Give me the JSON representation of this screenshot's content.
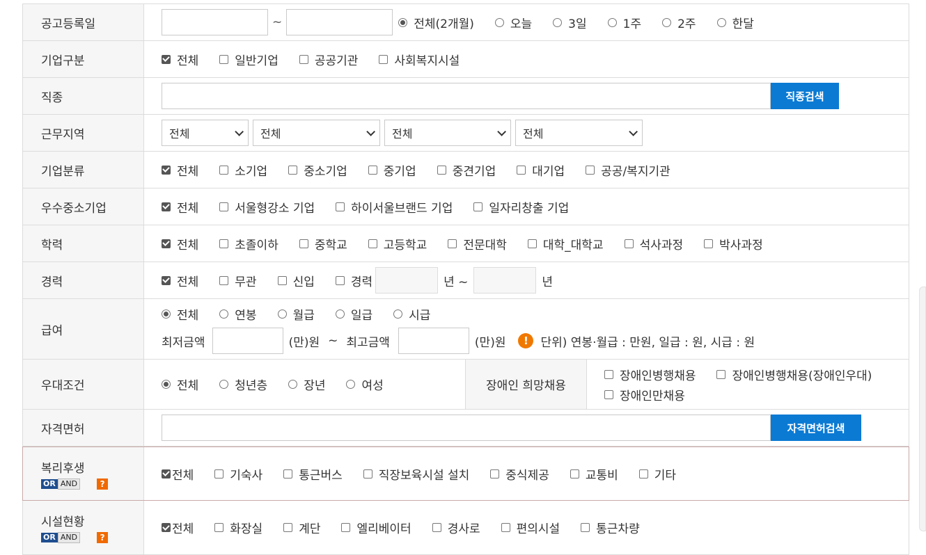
{
  "rows": {
    "posting_date": {
      "label": "공고등록일",
      "tilde": "~",
      "options": [
        "전체(2개월)",
        "오늘",
        "3일",
        "1주",
        "2주",
        "한달"
      ]
    },
    "company_type": {
      "label": "기업구분",
      "options": [
        "전체",
        "일반기업",
        "공공기관",
        "사회복지시설"
      ]
    },
    "job_type": {
      "label": "직종",
      "button": "직종검색"
    },
    "work_area": {
      "label": "근무지역",
      "selects": [
        "전체",
        "전체",
        "전체",
        "전체"
      ]
    },
    "company_class": {
      "label": "기업분류",
      "options": [
        "전체",
        "소기업",
        "중소기업",
        "중기업",
        "중견기업",
        "대기업",
        "공공/복지기관"
      ]
    },
    "excellent_sme": {
      "label": "우수중소기업",
      "options": [
        "전체",
        "서울형강소 기업",
        "하이서울브랜드 기업",
        "일자리창출 기업"
      ]
    },
    "education": {
      "label": "학력",
      "options": [
        "전체",
        "초졸이하",
        "중학교",
        "고등학교",
        "전문대학",
        "대학_대학교",
        "석사과정",
        "박사과정"
      ]
    },
    "career": {
      "label": "경력",
      "options": [
        "전체",
        "무관",
        "신입",
        "경력"
      ],
      "year_from": "년 ~",
      "year_to": "년"
    },
    "salary": {
      "label": "급여",
      "options": [
        "전체",
        "연봉",
        "월급",
        "일급",
        "시급"
      ],
      "min_label": "최저금액",
      "unit1": "(만)원",
      "tilde": "~",
      "max_label": "최고금액",
      "unit2": "(만)원",
      "warn_glyph": "!",
      "unit_note": "단위) 연봉·월급 : 만원, 일급 : 원, 시급 : 원"
    },
    "preference": {
      "label": "우대조건",
      "options": [
        "전체",
        "청년층",
        "장년",
        "여성"
      ],
      "disabled_label": "장애인 희망채용",
      "disabled_options": [
        "장애인병행채용",
        "장애인병행채용(장애인우대)",
        "장애인만채용"
      ]
    },
    "license": {
      "label": "자격면허",
      "button": "자격면허검색"
    },
    "welfare": {
      "label": "복리후생",
      "or": "OR",
      "and": "AND",
      "q": "?",
      "options": [
        "전체",
        "기숙사",
        "통근버스",
        "직장보육시설 설치",
        "중식제공",
        "교통비",
        "기타"
      ]
    },
    "facilities": {
      "label": "시설현황",
      "or": "OR",
      "and": "AND",
      "q": "?",
      "options": [
        "전체",
        "화장실",
        "계단",
        "엘리베이터",
        "경사로",
        "편의시설",
        "통근차량"
      ]
    }
  }
}
